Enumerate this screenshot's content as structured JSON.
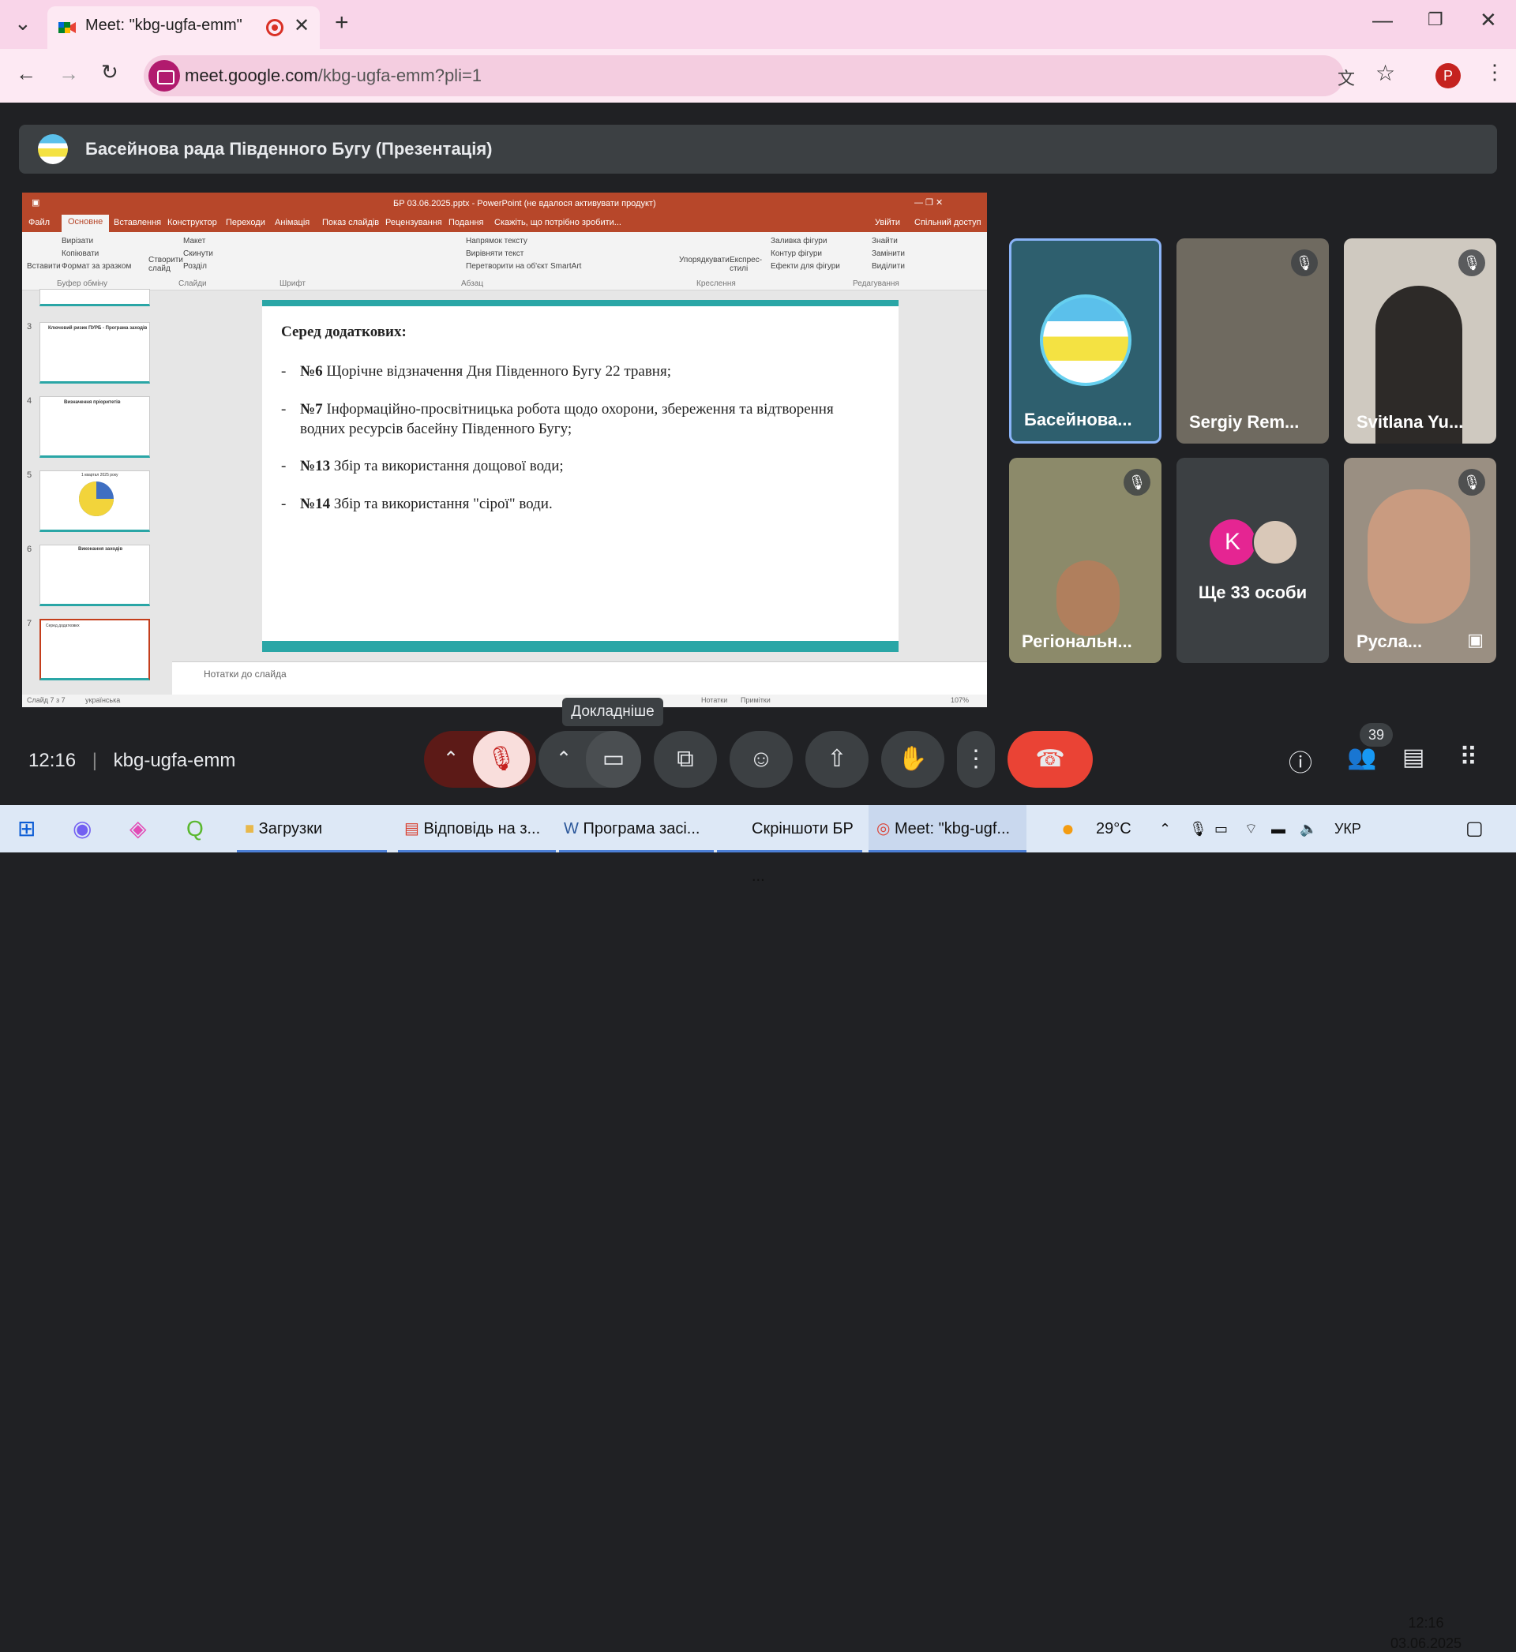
{
  "browser": {
    "tab_title": "Meet: \"kbg-ugfa-emm\"",
    "url_host": "meet.google.com",
    "url_path": "/kbg-ugfa-emm?pli=1",
    "profile_initial": "P"
  },
  "meet": {
    "presenter_banner": "Басейнова рада Південного Бугу (Презентація)",
    "time": "12:16",
    "meeting_code": "kbg-ugfa-emm",
    "tooltip": "Докладніше",
    "participants_count": "39"
  },
  "powerpoint": {
    "title": "БР 03.06.2025.pptx - PowerPoint (не вдалося активувати продукт)",
    "tabs": [
      "Файл",
      "Основне",
      "Вставлення",
      "Конструктор",
      "Переходи",
      "Анімація",
      "Показ слайдів",
      "Рецензування",
      "Подання",
      "Скажіть, що потрібно зробити..."
    ],
    "sign_in": "Увійти",
    "share": "Спільний доступ",
    "ribbon_groups": [
      "Буфер обміну",
      "Слайди",
      "Шрифт",
      "Абзац",
      "Креслення",
      "Редагування"
    ],
    "ribbon_items": [
      "Вставити",
      "Вирізати",
      "Копіювати",
      "Формат за зразком",
      "Створити слайд",
      "Макет",
      "Скинути",
      "Розділ",
      "Напрямок тексту",
      "Вирівняти текст",
      "Перетворити на об'єкт SmartArt",
      "Упорядкувати",
      "Експрес-стилі",
      "Заливка фігури",
      "Контур фігури",
      "Ефекти для фігури",
      "Знайти",
      "Замінити",
      "Виділити"
    ],
    "thumbnails": [
      {
        "num": "3",
        "title": "Ключовий ризик ПУРБ - Програма заходів"
      },
      {
        "num": "4",
        "title": "Визначення пріоритетів"
      },
      {
        "num": "5",
        "title": "1 квартал 2025 року"
      },
      {
        "num": "6",
        "title": "Виконання заходів"
      },
      {
        "num": "7",
        "title": "Серед додаткових"
      }
    ],
    "notes_placeholder": "Нотатки до слайда",
    "status_slide": "Слайд 7 з 7",
    "status_lang": "українська",
    "status_notes": "Нотатки",
    "status_comments": "Примітки",
    "zoom": "107%"
  },
  "slide": {
    "heading": "Серед додаткових:",
    "bullets": [
      {
        "num": "№6",
        "text": "Щорічне відзначення Дня Південного Бугу 22 травня;"
      },
      {
        "num": "№7",
        "text": "Інформаційно-просвітницька робота щодо охорони, збереження та відтворення водних ресурсів басейну Південного Бугу;"
      },
      {
        "num": "№13",
        "text": "Збір та використання дощової води;"
      },
      {
        "num": "№14",
        "text": "Збір та використання \"сірої\" води."
      }
    ]
  },
  "participants": [
    {
      "name": "Басейнова..."
    },
    {
      "name": "Sergiy Rem..."
    },
    {
      "name": "Svitlana Yu..."
    },
    {
      "name": "Регіональн..."
    },
    {
      "name": "Ще 33 особи",
      "avatar_initial": "K"
    },
    {
      "name": "Русла..."
    }
  ],
  "taskbar": {
    "items": [
      "Загрузки",
      "Відповідь на з...",
      "Програма засі...",
      "Скріншоти БР ...",
      "Meet: \"kbg-ugf..."
    ],
    "weather": "29°C",
    "lang": "УКР",
    "time": "12:16",
    "date": "03.06.2025"
  },
  "colors": {
    "tab_bg": "#f9d5e9",
    "meet_bg": "#202124",
    "end_call": "#ea4335",
    "ppt_accent": "#b7472a",
    "slide_accent": "#2aa6a6"
  }
}
